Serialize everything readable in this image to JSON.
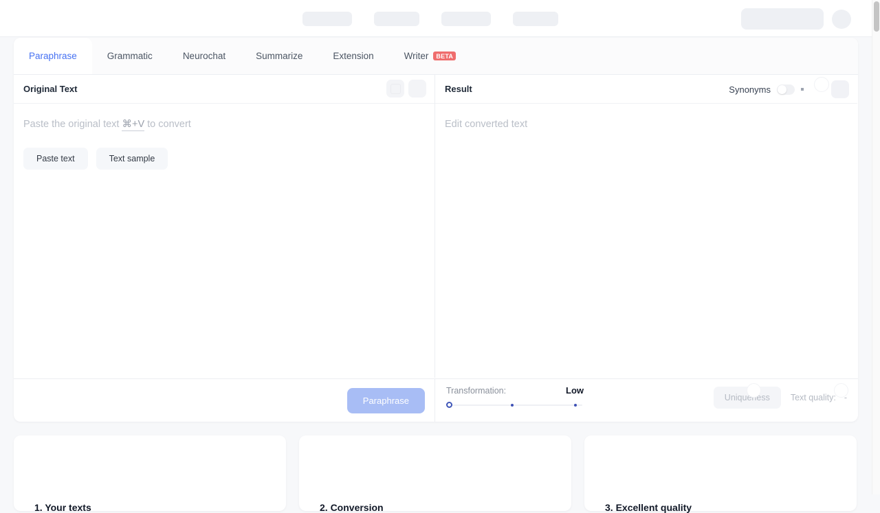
{
  "header": {
    "nav_placeholders": [
      "",
      "",
      "",
      ""
    ],
    "account_placeholder": "",
    "avatar_placeholder": ""
  },
  "tabs": [
    {
      "label": "Paraphrase",
      "active": true,
      "badge": ""
    },
    {
      "label": "Grammatic",
      "active": false,
      "badge": ""
    },
    {
      "label": "Neurochat",
      "active": false,
      "badge": ""
    },
    {
      "label": "Summarize",
      "active": false,
      "badge": ""
    },
    {
      "label": "Extension",
      "active": false,
      "badge": ""
    },
    {
      "label": "Writer",
      "active": false,
      "badge": "BETA"
    }
  ],
  "left_pane": {
    "title": "Original Text",
    "placeholder_prefix": "Paste the original text ",
    "placeholder_kbd": "⌘+V",
    "placeholder_suffix": " to convert",
    "paste_button": "Paste text",
    "sample_button": "Text sample"
  },
  "right_pane": {
    "title": "Result",
    "synonyms_label": "Synonyms",
    "synonyms_on": false,
    "placeholder": "Edit converted text"
  },
  "bottom_bar": {
    "paraphrase_button": "Paraphrase",
    "transformation_label": "Transformation:",
    "transformation_value": "Low",
    "transformation_steps": 3,
    "transformation_selected": 0,
    "uniqueness_button": "Uniqueness",
    "text_quality_label": "Text quality:",
    "text_quality_value": "-"
  },
  "promo_cards": [
    {
      "title": "1. Your texts"
    },
    {
      "title": "2. Conversion"
    },
    {
      "title": "3. Excellent quality"
    }
  ],
  "colors": {
    "accent": "#4671f2",
    "badge": "#ef6d6d",
    "button_disabled": "#a8bdf5",
    "slider": "#3f51b5",
    "page_bg": "#f7f8fa",
    "skeleton": "#eef0f4"
  }
}
